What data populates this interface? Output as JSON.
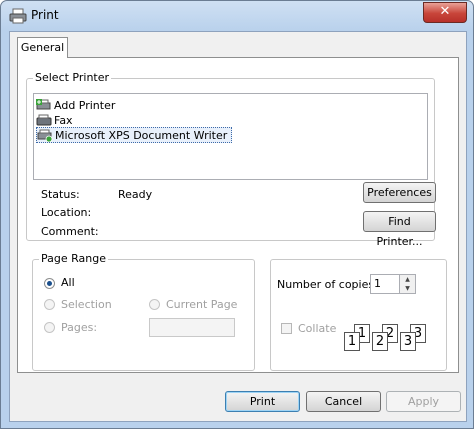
{
  "window": {
    "title": "Print",
    "close_symbol": "✕"
  },
  "tabs": [
    {
      "label": "General"
    }
  ],
  "select_printer": {
    "legend": "Select Printer",
    "printers": [
      {
        "label": "Add Printer",
        "icon": "add-printer-icon"
      },
      {
        "label": "Fax",
        "icon": "fax-icon"
      },
      {
        "label": "Microsoft XPS Document Writer",
        "icon": "printer-icon",
        "selected": true
      }
    ],
    "status_label": "Status:",
    "status_value": "Ready",
    "location_label": "Location:",
    "location_value": "",
    "comment_label": "Comment:",
    "comment_value": "",
    "preferences_button": "Preferences",
    "find_printer_button": "Find Printer..."
  },
  "page_range": {
    "legend": "Page Range",
    "options": [
      {
        "label": "All",
        "checked": true,
        "enabled": true
      },
      {
        "label": "Selection",
        "checked": false,
        "enabled": false
      },
      {
        "label": "Current Page",
        "checked": false,
        "enabled": false
      },
      {
        "label": "Pages:",
        "checked": false,
        "enabled": false
      }
    ],
    "pages_value": ""
  },
  "copies": {
    "label": "Number of copies:",
    "value": "1",
    "collate_label": "Collate",
    "collate_checked": false,
    "collate_pages": [
      "1",
      "1",
      "2",
      "2",
      "3",
      "3"
    ]
  },
  "buttons": {
    "print": "Print",
    "cancel": "Cancel",
    "apply": "Apply"
  },
  "colors": {
    "title_gradient": "#b9d1ec",
    "selection_border": "#3d6aa8",
    "close_red": "#c8453a"
  }
}
